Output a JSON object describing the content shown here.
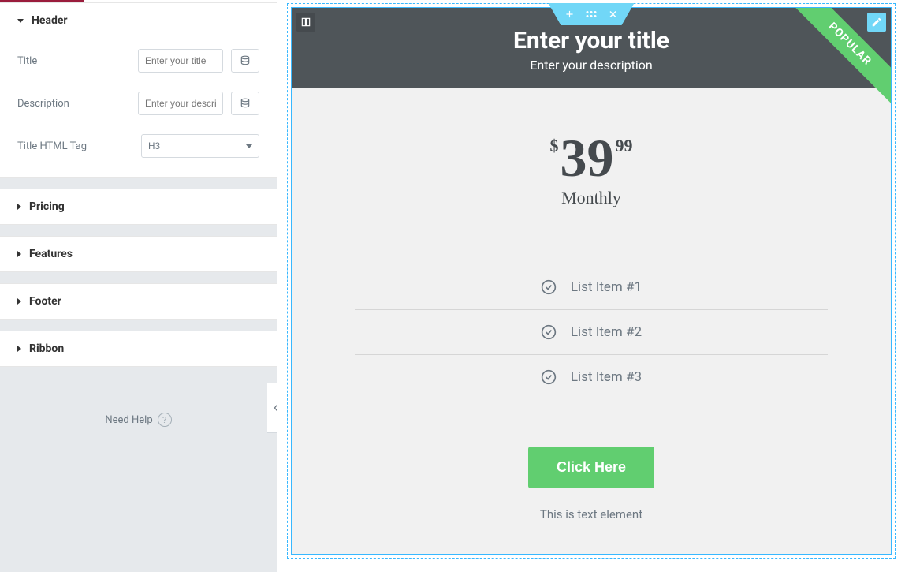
{
  "panel": {
    "sections": {
      "header": {
        "label": "Header",
        "title_field": {
          "label": "Title",
          "placeholder": "Enter your title"
        },
        "desc_field": {
          "label": "Description",
          "placeholder": "Enter your description"
        },
        "html_tag_field": {
          "label": "Title HTML Tag",
          "value": "H3"
        }
      },
      "pricing_label": "Pricing",
      "features_label": "Features",
      "footer_label": "Footer",
      "ribbon_label": "Ribbon"
    },
    "need_help_label": "Need Help"
  },
  "card": {
    "ribbon": "POPULAR",
    "title": "Enter your title",
    "description": "Enter your description",
    "currency": "$",
    "price": "39",
    "cents": "99",
    "period": "Monthly",
    "features": [
      "List Item #1",
      "List Item #2",
      "List Item #3"
    ],
    "cta": "Click Here",
    "footer_text": "This is text element"
  }
}
